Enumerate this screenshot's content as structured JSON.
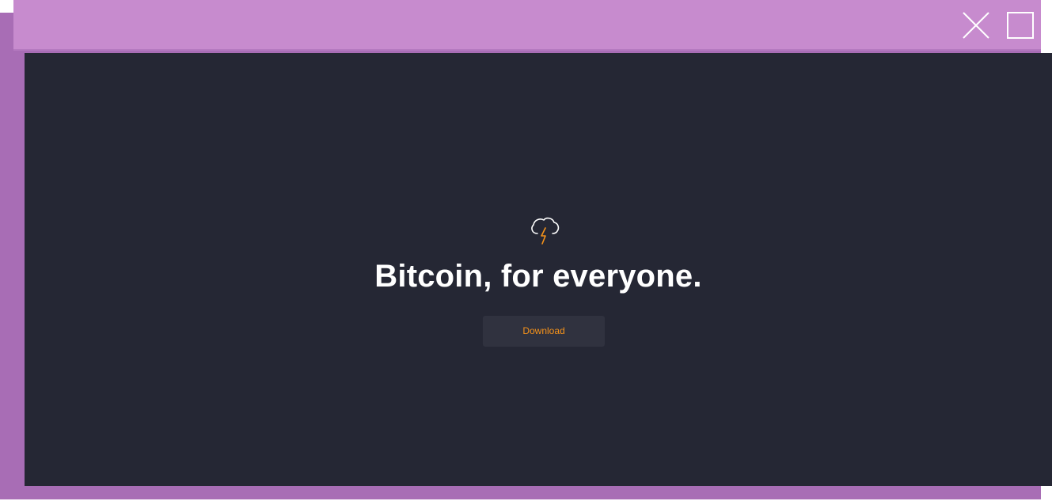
{
  "window": {
    "close_icon": "close-icon",
    "maximize_icon": "maximize-icon"
  },
  "hero": {
    "logo_icon": "cloud-lightning-icon",
    "headline": "Bitcoin, for everyone.",
    "download_label": "Download"
  },
  "colors": {
    "frame": "#a86db5",
    "titlebar": "#c78bce",
    "background": "#252734",
    "button_bg": "#30323f",
    "accent": "#f7931a",
    "text": "#ffffff"
  }
}
